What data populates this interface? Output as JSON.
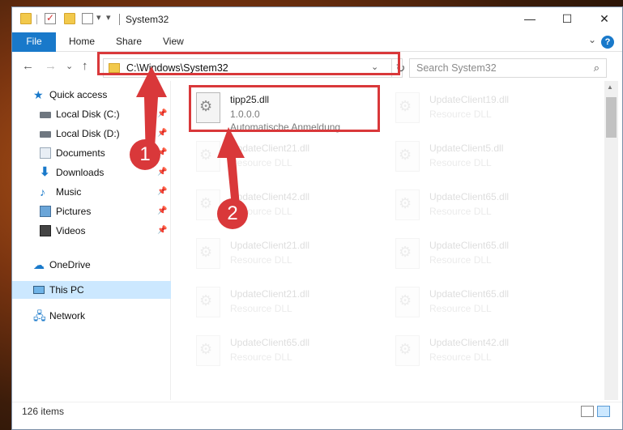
{
  "titlebar": {
    "title": "System32",
    "minimize": "—",
    "maximize": "☐",
    "close": "✕"
  },
  "ribbon": {
    "tabs": [
      "File",
      "Home",
      "Share",
      "View"
    ],
    "help": "?",
    "expand": "⌄"
  },
  "nav": {
    "back": "←",
    "forward": "→",
    "recent": "⌄",
    "up": "↑"
  },
  "address": {
    "path": "C:\\Windows\\System32",
    "dropdown": "⌄",
    "refresh": "↻"
  },
  "search": {
    "placeholder": "Search System32",
    "icon": "⌕"
  },
  "sidebar": {
    "items": [
      {
        "label": "Quick access",
        "icon": "star-icon",
        "pinned": false
      },
      {
        "label": "Local Disk (C:)",
        "icon": "disk-icon",
        "pinned": true
      },
      {
        "label": "Local Disk (D:)",
        "icon": "disk-icon",
        "pinned": true
      },
      {
        "label": "Documents",
        "icon": "documents-icon",
        "pinned": true
      },
      {
        "label": "Downloads",
        "icon": "downloads-icon",
        "pinned": true
      },
      {
        "label": "Music",
        "icon": "music-icon",
        "pinned": true
      },
      {
        "label": "Pictures",
        "icon": "pictures-icon",
        "pinned": true
      },
      {
        "label": "Videos",
        "icon": "videos-icon",
        "pinned": true
      },
      {
        "label": "OneDrive",
        "icon": "cloud-icon",
        "pinned": false
      },
      {
        "label": "This PC",
        "icon": "computer-icon",
        "pinned": false,
        "selected": true
      },
      {
        "label": "Network",
        "icon": "network-icon",
        "pinned": false
      }
    ],
    "pin_glyph": "📌"
  },
  "files": {
    "highlighted": {
      "name": "tipp25.dll",
      "version": "1.0.0.0",
      "description": "Automatische Anmeldung"
    },
    "faded": [
      {
        "name": "UpdateClient19.dll",
        "type": "Resource DLL"
      },
      {
        "name": "UpdateClient21.dll",
        "type": "Resource DLL"
      },
      {
        "name": "UpdateClient5.dll",
        "type": "Resource DLL"
      },
      {
        "name": "UpdateClient42.dll",
        "type": "Resource DLL"
      },
      {
        "name": "UpdateClient65.dll",
        "type": "Resource DLL"
      },
      {
        "name": "UpdateClient21.dll",
        "type": "Resource DLL"
      },
      {
        "name": "UpdateClient65.dll",
        "type": "Resource DLL"
      },
      {
        "name": "UpdateClient21.dll",
        "type": "Resource DLL"
      },
      {
        "name": "UpdateClient65.dll",
        "type": "Resource DLL"
      },
      {
        "name": "UpdateClient65.dll",
        "type": "Resource DLL"
      },
      {
        "name": "UpdateClient42.dll",
        "type": "Resource DLL"
      }
    ]
  },
  "status": {
    "item_count": "126 items"
  },
  "annotations": {
    "step1": "1",
    "step2": "2",
    "color": "#d9383a"
  }
}
